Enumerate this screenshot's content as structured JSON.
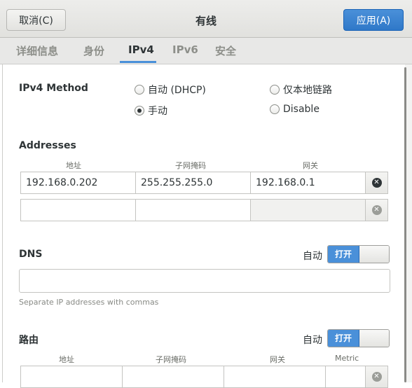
{
  "header": {
    "cancel_label": "取消(C)",
    "title": "有线",
    "apply_label": "应用(A)"
  },
  "tabs": [
    {
      "label": "详细信息"
    },
    {
      "label": "身份"
    },
    {
      "label": "IPv4"
    },
    {
      "label": "IPv6"
    },
    {
      "label": "安全"
    }
  ],
  "active_tab": "IPv4",
  "ipv4": {
    "method_label": "IPv4 Method",
    "methods": [
      {
        "label": "自动 (DHCP)",
        "selected": false
      },
      {
        "label": "仅本地链路",
        "selected": false
      },
      {
        "label": "手动",
        "selected": true
      },
      {
        "label": "Disable",
        "selected": false
      }
    ],
    "addresses": {
      "title": "Addresses",
      "col_address": "地址",
      "col_netmask": "子网掩码",
      "col_gateway": "网关",
      "rows": [
        {
          "address": "192.168.0.202",
          "netmask": "255.255.255.0",
          "gateway": "192.168.0.1"
        },
        {
          "address": "",
          "netmask": "",
          "gateway": ""
        }
      ]
    },
    "dns": {
      "title": "DNS",
      "auto_label": "自动",
      "toggle_label": "打开",
      "toggle_on": true,
      "value": "",
      "hint": "Separate IP addresses with commas"
    },
    "routes": {
      "title": "路由",
      "auto_label": "自动",
      "toggle_label": "打开",
      "toggle_on": true,
      "col_address": "地址",
      "col_netmask": "子网掩码",
      "col_gateway": "网关",
      "col_metric": "Metric"
    }
  },
  "colors": {
    "accent": "#4a90d9",
    "header_bg": "#e8e8e7",
    "text": "#2e3436"
  }
}
